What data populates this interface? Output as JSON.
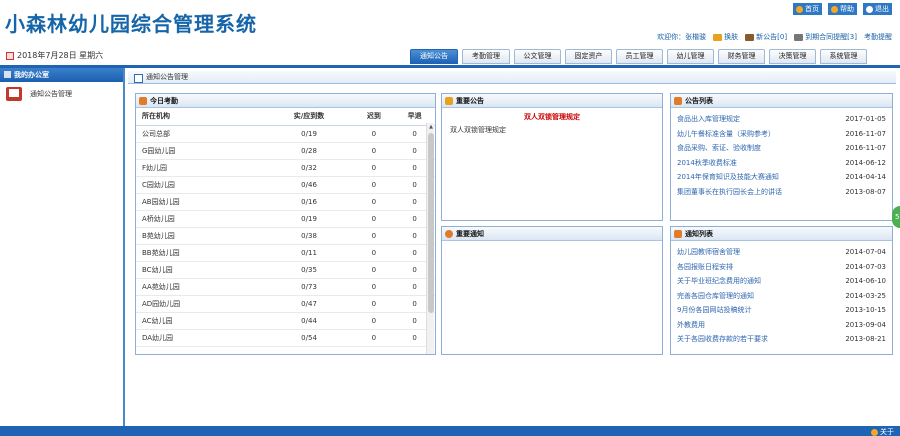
{
  "app": {
    "title": "小森林幼儿园综合管理系统"
  },
  "top_links": [
    {
      "label": "首页",
      "icon": "home-icon"
    },
    {
      "label": "帮助",
      "icon": "help-icon"
    },
    {
      "label": "退出",
      "icon": "exit-icon"
    }
  ],
  "user_bar": {
    "welcome": "欢迎你：张楷骏",
    "items": [
      {
        "label": "换肤",
        "icon": "skin-icon"
      },
      {
        "label": "新公告[0]",
        "icon": "notice-icon"
      },
      {
        "label": "到期合同提醒[3]",
        "icon": "contract-icon"
      },
      {
        "label": "考勤提醒",
        "icon": "attendance-icon"
      }
    ]
  },
  "date": "2018年7月28日 星期六",
  "tabs": [
    "通知公告",
    "考勤管理",
    "公文管理",
    "固定资产",
    "员工管理",
    "幼儿管理",
    "财务管理",
    "决策管理",
    "系统管理"
  ],
  "sidebar": {
    "title": "我的办公室",
    "item": "通知公告管理"
  },
  "breadcrumb": "通知公告管理",
  "attendance": {
    "title": "今日考勤",
    "headers": [
      "所在机构",
      "实/应到数",
      "迟到",
      "早退"
    ],
    "rows": [
      [
        "公司总部",
        "0/19",
        "0",
        "0"
      ],
      [
        "G园幼儿园",
        "0/28",
        "0",
        "0"
      ],
      [
        "F幼儿园",
        "0/32",
        "0",
        "0"
      ],
      [
        "C园幼儿园",
        "0/46",
        "0",
        "0"
      ],
      [
        "AB园幼儿园",
        "0/16",
        "0",
        "0"
      ],
      [
        "A桥幼儿园",
        "0/19",
        "0",
        "0"
      ],
      [
        "B苑幼儿园",
        "0/38",
        "0",
        "0"
      ],
      [
        "BB苑幼儿园",
        "0/11",
        "0",
        "0"
      ],
      [
        "BC幼儿园",
        "0/35",
        "0",
        "0"
      ],
      [
        "AA苑幼儿园",
        "0/73",
        "0",
        "0"
      ],
      [
        "AD园幼儿园",
        "0/47",
        "0",
        "0"
      ],
      [
        "AC幼儿园",
        "0/44",
        "0",
        "0"
      ],
      [
        "DA幼儿园",
        "0/54",
        "0",
        "0"
      ]
    ]
  },
  "important_notice": {
    "title": "重要公告",
    "headline": "双人双锁管理规定",
    "body": "双人双锁管理规定"
  },
  "important_inform": {
    "title": "重要通知"
  },
  "notice_list": {
    "title": "公告列表",
    "items": [
      {
        "title": "食品出入库管理规定",
        "date": "2017-01-05"
      },
      {
        "title": "幼儿午餐标准含量（采购参考）",
        "date": "2016-11-07"
      },
      {
        "title": "食品采购、索证、验收制度",
        "date": "2016-11-07"
      },
      {
        "title": "2014秋季收费标准",
        "date": "2014-06-12"
      },
      {
        "title": "2014年保育知识及技能大赛通知",
        "date": "2014-04-14"
      },
      {
        "title": "集团董事长在执行园长会上的讲话",
        "date": "2013-08-07"
      }
    ]
  },
  "inform_list": {
    "title": "通知列表",
    "items": [
      {
        "title": "幼儿园教师宿舍管理",
        "date": "2014-07-04"
      },
      {
        "title": "各园报账日程安排",
        "date": "2014-07-03"
      },
      {
        "title": "关于毕业班纪念费用的通知",
        "date": "2014-06-10"
      },
      {
        "title": "完善各园仓库管理的通知",
        "date": "2014-03-25"
      },
      {
        "title": "9月份各园网站投稿统计",
        "date": "2013-10-15"
      },
      {
        "title": "外教费用",
        "date": "2013-09-04"
      },
      {
        "title": "关于各园收费存款的若干要求",
        "date": "2013-08-21"
      }
    ]
  },
  "footer": {
    "label": "关于"
  },
  "colors": {
    "accent": "#1f64b4",
    "link": "#2f66b0",
    "alert": "#cc0000"
  }
}
